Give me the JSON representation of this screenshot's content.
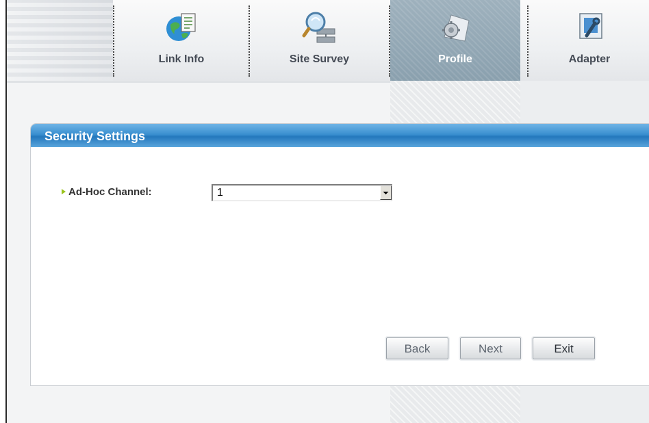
{
  "toolbar": {
    "tabs": [
      {
        "label": "Link Info",
        "icon": "globe-document-icon",
        "active": false
      },
      {
        "label": "Site Survey",
        "icon": "network-search-icon",
        "active": false
      },
      {
        "label": "Profile",
        "icon": "profile-gear-icon",
        "active": true
      },
      {
        "label": "Adapter",
        "icon": "adapter-tool-icon",
        "active": false
      }
    ]
  },
  "panel": {
    "title": "Security Settings",
    "field": {
      "label": "Ad-Hoc Channel:",
      "selected_value": "1"
    },
    "buttons": {
      "back": "Back",
      "next": "Next",
      "exit": "Exit"
    }
  },
  "colors": {
    "header_blue": "#2f86cc",
    "active_tab": "#93a8b6",
    "bullet": "#9ac31c"
  }
}
